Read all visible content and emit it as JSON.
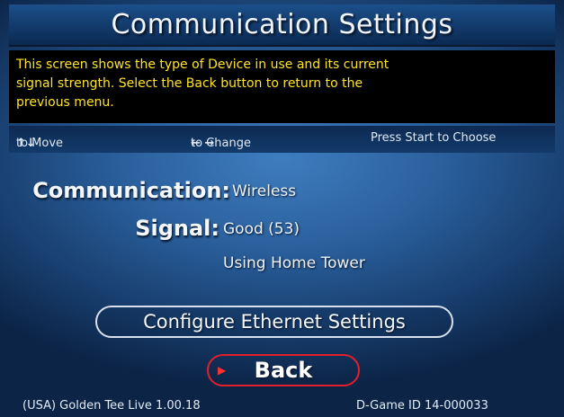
{
  "title": "Communication Settings",
  "info": {
    "lines": [
      "This screen shows the type of Device in use and its current",
      "signal strength.  Select the Back button to return to the",
      "previous menu."
    ]
  },
  "help": {
    "move_arrows": "↑↓",
    "move_text": "to Move",
    "change_arrows": "← →",
    "change_text": "to Change",
    "choose_text": "Press Start to Choose"
  },
  "status": {
    "communication_label": "Communication:",
    "communication_value": "Wireless",
    "signal_label": "Signal:",
    "signal_value": "Good (53)",
    "tower_value": "Using Home Tower"
  },
  "buttons": {
    "ethernet": "Configure Ethernet Settings",
    "back": "Back"
  },
  "footer": {
    "version": "(USA) Golden Tee Live 1.00.18",
    "game_id": "D-Game ID 14-000033"
  },
  "colors": {
    "info_text": "#ffe32a",
    "back_border": "#e3202a",
    "background": "#2a5f9c"
  }
}
